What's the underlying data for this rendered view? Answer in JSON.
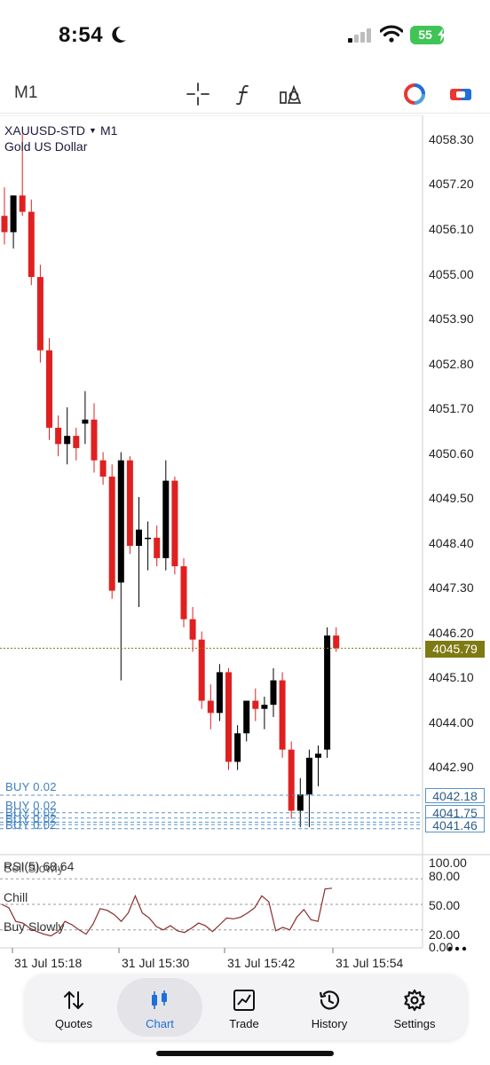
{
  "status_bar": {
    "time": "8:54",
    "battery": "55"
  },
  "toolbar": {
    "timeframe": "M1"
  },
  "chart": {
    "symbol": "XAUUSD-STD",
    "timeframe": "M1",
    "description": "Gold US Dollar",
    "price_axis": [
      "4058.30",
      "4057.20",
      "4056.10",
      "4055.00",
      "4053.90",
      "4052.80",
      "4051.70",
      "4050.60",
      "4049.50",
      "4048.40",
      "4047.30",
      "4046.20",
      "4045.10",
      "4044.00",
      "4042.90"
    ],
    "current_price": "4045.79",
    "order_price_boxes": [
      "4042.18",
      "4041.75",
      "4041.46"
    ],
    "order_labels": [
      "BUY 0.02",
      "BUY 0.02",
      "BUY 0.02",
      "BUY 0.02",
      "BUY 0.02"
    ],
    "rsi_title": "RSI(5) 68.64",
    "rsi_scale": [
      "100.00",
      "80.00",
      "50.00",
      "20.00",
      "0.00"
    ],
    "overlay_texts": [
      "Sell Slowly",
      "Chill",
      "Buy Slowly"
    ],
    "time_axis": [
      "31 Jul 15:18",
      "31 Jul 15:30",
      "31 Jul 15:42",
      "31 Jul 15:54"
    ],
    "colors": {
      "bull": "#000000",
      "bear": "#e02020",
      "current_price_line": "#7e7a12",
      "order_line": "#5a93c7"
    }
  },
  "chart_data": {
    "type": "candlestick",
    "symbol": "XAUUSD-STD",
    "timeframe": "M1",
    "ylim": [
      4041.2,
      4058.6
    ],
    "candles": [
      {
        "o": 4056.4,
        "h": 4057.1,
        "l": 4055.7,
        "c": 4056.0
      },
      {
        "o": 4056.0,
        "h": 4056.9,
        "l": 4055.6,
        "c": 4056.9
      },
      {
        "o": 4056.9,
        "h": 4058.4,
        "l": 4056.4,
        "c": 4056.5
      },
      {
        "o": 4056.5,
        "h": 4056.8,
        "l": 4054.7,
        "c": 4054.9
      },
      {
        "o": 4054.9,
        "h": 4055.2,
        "l": 4052.8,
        "c": 4053.1
      },
      {
        "o": 4053.1,
        "h": 4053.4,
        "l": 4050.9,
        "c": 4051.2
      },
      {
        "o": 4051.2,
        "h": 4051.5,
        "l": 4050.5,
        "c": 4050.8
      },
      {
        "o": 4050.8,
        "h": 4051.7,
        "l": 4050.3,
        "c": 4051.0
      },
      {
        "o": 4051.0,
        "h": 4051.2,
        "l": 4050.4,
        "c": 4050.7
      },
      {
        "o": 4051.3,
        "h": 4052.1,
        "l": 4050.8,
        "c": 4051.4
      },
      {
        "o": 4051.4,
        "h": 4051.8,
        "l": 4050.1,
        "c": 4050.4
      },
      {
        "o": 4050.4,
        "h": 4050.6,
        "l": 4049.8,
        "c": 4050.0
      },
      {
        "o": 4050.0,
        "h": 4050.3,
        "l": 4047.0,
        "c": 4047.2
      },
      {
        "o": 4047.4,
        "h": 4050.6,
        "l": 4045.0,
        "c": 4050.4
      },
      {
        "o": 4050.4,
        "h": 4050.5,
        "l": 4048.1,
        "c": 4048.3
      },
      {
        "o": 4048.3,
        "h": 4049.5,
        "l": 4046.8,
        "c": 4048.7
      },
      {
        "o": 4048.5,
        "h": 4048.9,
        "l": 4047.7,
        "c": 4048.5
      },
      {
        "o": 4048.5,
        "h": 4048.8,
        "l": 4047.8,
        "c": 4048.0
      },
      {
        "o": 4048.0,
        "h": 4050.4,
        "l": 4047.7,
        "c": 4049.9
      },
      {
        "o": 4049.9,
        "h": 4050.0,
        "l": 4047.6,
        "c": 4047.8
      },
      {
        "o": 4047.8,
        "h": 4048.0,
        "l": 4046.3,
        "c": 4046.5
      },
      {
        "o": 4046.5,
        "h": 4046.8,
        "l": 4045.7,
        "c": 4046.0
      },
      {
        "o": 4046.0,
        "h": 4046.2,
        "l": 4044.3,
        "c": 4044.5
      },
      {
        "o": 4044.5,
        "h": 4044.9,
        "l": 4043.8,
        "c": 4044.2
      },
      {
        "o": 4044.2,
        "h": 4045.4,
        "l": 4044.0,
        "c": 4045.2
      },
      {
        "o": 4045.2,
        "h": 4045.3,
        "l": 4042.8,
        "c": 4043.0
      },
      {
        "o": 4043.0,
        "h": 4043.9,
        "l": 4042.8,
        "c": 4043.7
      },
      {
        "o": 4043.7,
        "h": 4044.5,
        "l": 4043.5,
        "c": 4044.5
      },
      {
        "o": 4044.5,
        "h": 4044.8,
        "l": 4044.0,
        "c": 4044.3
      },
      {
        "o": 4044.3,
        "h": 4044.6,
        "l": 4043.8,
        "c": 4044.4
      },
      {
        "o": 4044.4,
        "h": 4045.3,
        "l": 4044.1,
        "c": 4045.0
      },
      {
        "o": 4045.0,
        "h": 4045.2,
        "l": 4043.1,
        "c": 4043.3
      },
      {
        "o": 4043.3,
        "h": 4043.5,
        "l": 4041.6,
        "c": 4041.8
      },
      {
        "o": 4041.8,
        "h": 4042.6,
        "l": 4041.4,
        "c": 4042.2
      },
      {
        "o": 4042.2,
        "h": 4043.3,
        "l": 4041.4,
        "c": 4043.1
      },
      {
        "o": 4043.1,
        "h": 4043.4,
        "l": 4042.4,
        "c": 4043.2
      },
      {
        "o": 4043.3,
        "h": 4046.3,
        "l": 4043.1,
        "c": 4046.1
      },
      {
        "o": 4046.1,
        "h": 4046.3,
        "l": 4045.7,
        "c": 4045.79
      }
    ],
    "rsi": {
      "ylim": [
        0,
        100
      ],
      "levels": [
        80,
        50,
        20
      ],
      "values": [
        50,
        46,
        30,
        28,
        22,
        18,
        15,
        13,
        18,
        30,
        26,
        20,
        15,
        27,
        45,
        43,
        38,
        30,
        40,
        60,
        40,
        34,
        24,
        20,
        25,
        19,
        17,
        22,
        28,
        25,
        18,
        26,
        34,
        33,
        35,
        40,
        46,
        60,
        53,
        19,
        23,
        20,
        35,
        44,
        32,
        30,
        68,
        69
      ]
    }
  }
}
